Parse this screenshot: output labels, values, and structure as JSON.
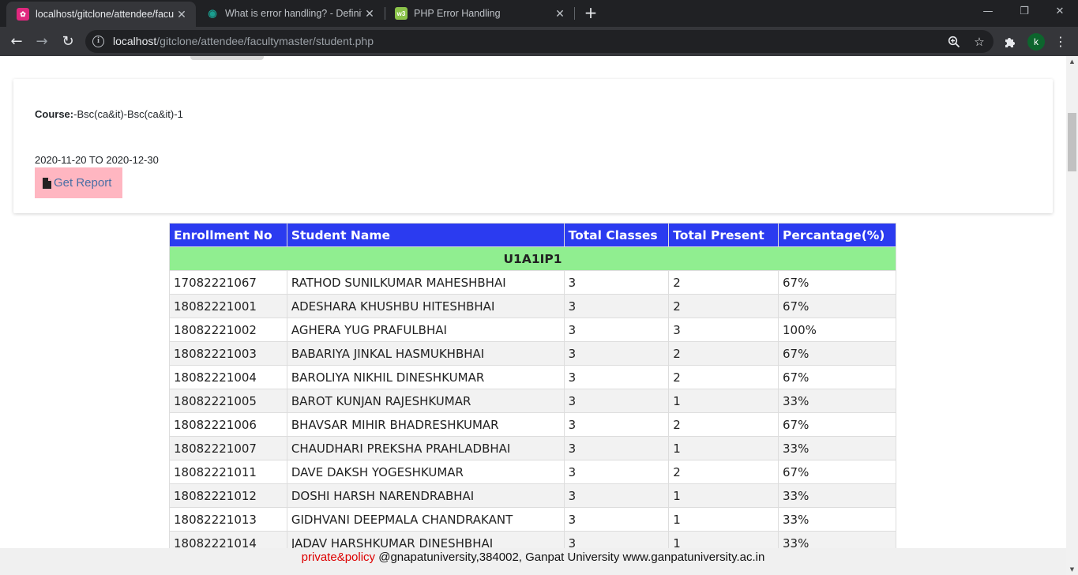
{
  "browser": {
    "tabs": [
      {
        "label": "localhost/gitclone/attendee/facul",
        "icon": "xampp-icon",
        "active": true
      },
      {
        "label": "What is error handling? - Definiti",
        "icon": "eye-icon",
        "active": false
      },
      {
        "label": "PHP Error Handling",
        "icon": "w3schools-icon",
        "active": false
      }
    ],
    "close_glyph": "✕",
    "new_tab_glyph": "+",
    "url_host": "localhost",
    "url_path": "/gitclone/attendee/facultymaster/student.php",
    "avatar_letter": "k"
  },
  "card": {
    "course_label": "Course:",
    "course_value": "-Bsc(ca&it)-Bsc(ca&it)-1",
    "date_range": "2020-11-20 TO 2020-12-30",
    "report_button": "Get Report"
  },
  "table": {
    "headers": [
      "Enrollment No",
      "Student Name",
      "Total Classes",
      "Total Present",
      "Percantage(%)"
    ],
    "group": "U1A1IP1",
    "rows": [
      [
        "17082221067",
        "RATHOD SUNILKUMAR MAHESHBHAI",
        "3",
        "2",
        "67%"
      ],
      [
        "18082221001",
        "ADESHARA KHUSHBU HITESHBHAI",
        "3",
        "2",
        "67%"
      ],
      [
        "18082221002",
        "AGHERA YUG PRAFULBHAI",
        "3",
        "3",
        "100%"
      ],
      [
        "18082221003",
        "BABARIYA JINKAL HASMUKHBHAI",
        "3",
        "2",
        "67%"
      ],
      [
        "18082221004",
        "BAROLIYA NIKHIL DINESHKUMAR",
        "3",
        "2",
        "67%"
      ],
      [
        "18082221005",
        "BAROT KUNJAN RAJESHKUMAR",
        "3",
        "1",
        "33%"
      ],
      [
        "18082221006",
        "BHAVSAR MIHIR BHADRESHKUMAR",
        "3",
        "2",
        "67%"
      ],
      [
        "18082221007",
        "CHAUDHARI PREKSHA PRAHLADBHAI",
        "3",
        "1",
        "33%"
      ],
      [
        "18082221011",
        "DAVE DAKSH YOGESHKUMAR",
        "3",
        "2",
        "67%"
      ],
      [
        "18082221012",
        "DOSHI HARSH NARENDRABHAI",
        "3",
        "1",
        "33%"
      ],
      [
        "18082221013",
        "GIDHVANI DEEPMALA CHANDRAKANT",
        "3",
        "1",
        "33%"
      ],
      [
        "18082221014",
        "JADAV HARSHKUMAR DINESHBHAI",
        "3",
        "1",
        "33%"
      ]
    ]
  },
  "footer": {
    "policy_link": "private&policy",
    "text": " @gnapatuniversity,384002, Ganpat University www.ganpatuniversity.ac.in"
  },
  "colors": {
    "header_bg": "#2b3bf0",
    "group_bg": "#90ee90",
    "report_button_bg": "#ffb6c1",
    "policy_link": "#dd0000"
  }
}
